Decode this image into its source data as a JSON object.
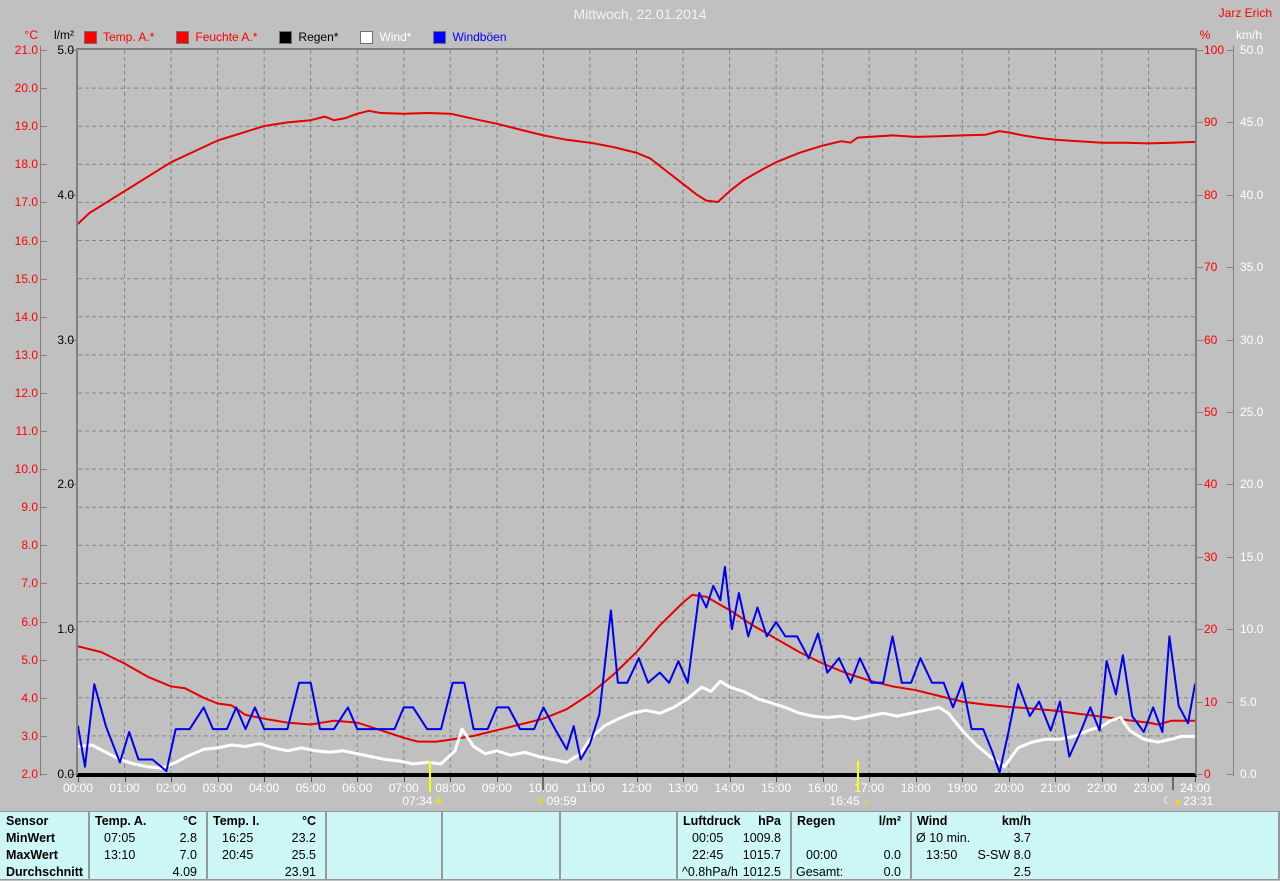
{
  "header": {
    "title": "Mittwoch, 22.01.2014",
    "author": "Jarz Erich"
  },
  "legend": [
    {
      "name": "temp-a",
      "label": "Temp. A.*",
      "swatch": "#ff0000",
      "text_color": "#ff0000"
    },
    {
      "name": "feuchte-a",
      "label": "Feuchte A.*",
      "swatch": "#ff0000",
      "text_color": "#ff0000"
    },
    {
      "name": "regen",
      "label": "Regen*",
      "swatch": "#000000",
      "text_color": "#000000"
    },
    {
      "name": "wind",
      "label": "Wind*",
      "swatch": "#ffffff",
      "text_color": "#ffffff"
    },
    {
      "name": "windboeen",
      "label": "Windböen",
      "swatch": "#0000ff",
      "text_color": "#0000ff"
    }
  ],
  "axes": {
    "temp": {
      "unit": "°C",
      "color": "#ff0000",
      "min": 2,
      "max": 21,
      "labels": [
        "21.0",
        "20.0",
        "19.0",
        "18.0",
        "17.0",
        "16.0",
        "15.0",
        "14.0",
        "13.0",
        "12.0",
        "11.0",
        "10.0",
        "9.0",
        "8.0",
        "7.0",
        "6.0",
        "5.0",
        "4.0",
        "3.0",
        "2.0"
      ]
    },
    "rain": {
      "unit": "l/m²",
      "color": "#000000",
      "min": 0,
      "max": 5,
      "labels": [
        "5.0",
        "4.0",
        "3.0",
        "2.0",
        "1.0",
        "0.0"
      ]
    },
    "humidity": {
      "unit": "%",
      "color": "#ff0000",
      "min": 0,
      "max": 100,
      "labels": [
        "100",
        "90",
        "80",
        "70",
        "60",
        "50",
        "40",
        "30",
        "20",
        "10",
        "0"
      ]
    },
    "wind": {
      "unit": "km/h",
      "color": "#ffffff",
      "min": 0,
      "max": 50,
      "labels": [
        "50.0",
        "45.0",
        "40.0",
        "35.0",
        "30.0",
        "25.0",
        "20.0",
        "15.0",
        "10.0",
        "5.0",
        "0.0"
      ]
    },
    "time": {
      "min": 0,
      "max": 24,
      "labels": [
        "00:00",
        "01:00",
        "02:00",
        "03:00",
        "04:00",
        "05:00",
        "06:00",
        "07:00",
        "08:00",
        "09:00",
        "10:00",
        "11:00",
        "12:00",
        "13:00",
        "14:00",
        "15:00",
        "16:00",
        "17:00",
        "18:00",
        "19:00",
        "20:00",
        "21:00",
        "22:00",
        "23:00",
        "24:00"
      ]
    }
  },
  "markers": [
    {
      "time": "07:34",
      "type": "sunrise",
      "icon": "sun"
    },
    {
      "time": "09:59",
      "type": "moonset",
      "icon": "arrow-down"
    },
    {
      "time": "16:45",
      "type": "sunset",
      "icon": "sun-outline"
    },
    {
      "time": "23:31",
      "type": "moonrise",
      "icon": "moon"
    }
  ],
  "chart_data": {
    "type": "line",
    "title": "Mittwoch, 22.01.2014",
    "x_range": [
      0,
      24
    ],
    "grid": "dashed hourly vertical, 1°C horizontal",
    "series": [
      {
        "name": "Feuchte A.",
        "unit": "%",
        "axis": "humidity",
        "color": "#e60000",
        "width": 2,
        "x": [
          0,
          0.25,
          0.5,
          0.75,
          1,
          1.5,
          2,
          2.5,
          3,
          3.5,
          4,
          4.5,
          5,
          5.3,
          5.5,
          5.75,
          6,
          6.25,
          6.5,
          7,
          7.5,
          8,
          8.5,
          9,
          9.5,
          10,
          10.5,
          11,
          11.5,
          12,
          12.3,
          12.6,
          13,
          13.3,
          13.5,
          13.75,
          14,
          14.3,
          14.7,
          15,
          15.5,
          16,
          16.4,
          16.6,
          16.75,
          17,
          17.5,
          18,
          18.5,
          19,
          19.5,
          19.8,
          20,
          20.3,
          20.7,
          21,
          21.5,
          22,
          22.5,
          23,
          23.5,
          24
        ],
        "y": [
          76,
          77.5,
          78.5,
          79.5,
          80.5,
          82.5,
          84.5,
          86,
          87.5,
          88.5,
          89.5,
          90,
          90.3,
          90.8,
          90.3,
          90.6,
          91.2,
          91.6,
          91.3,
          91.2,
          91.3,
          91.2,
          90.5,
          89.8,
          89,
          88.2,
          87.6,
          87.2,
          86.6,
          85.8,
          85,
          83.5,
          81.5,
          80,
          79.2,
          79,
          80.5,
          82,
          83.5,
          84.5,
          85.8,
          86.8,
          87.4,
          87.2,
          87.9,
          88,
          88.2,
          88,
          88.1,
          88.2,
          88.3,
          88.8,
          88.6,
          88.2,
          87.8,
          87.6,
          87.4,
          87.2,
          87.2,
          87.1,
          87.2,
          87.3
        ]
      },
      {
        "name": "Temp. A.",
        "unit": "°C",
        "axis": "temp",
        "color": "#e60000",
        "width": 2,
        "x": [
          0,
          0.5,
          1,
          1.5,
          2,
          2.3,
          2.7,
          3,
          3.3,
          3.6,
          4,
          4.5,
          5,
          5.5,
          6,
          6.5,
          7,
          7.3,
          7.7,
          8,
          8.5,
          9,
          9.5,
          10,
          10.5,
          11,
          11.5,
          12,
          12.5,
          13,
          13.2,
          13.5,
          14,
          14.5,
          15,
          15.5,
          16,
          16.5,
          17,
          17.5,
          18,
          18.5,
          19,
          19.5,
          20,
          20.5,
          21,
          21.5,
          22,
          22.5,
          23,
          23.2,
          23.5,
          24
        ],
        "y": [
          5.35,
          5.2,
          4.9,
          4.55,
          4.3,
          4.25,
          4.0,
          3.85,
          3.8,
          3.55,
          3.45,
          3.35,
          3.3,
          3.4,
          3.35,
          3.15,
          2.95,
          2.85,
          2.85,
          2.9,
          3.0,
          3.15,
          3.3,
          3.45,
          3.7,
          4.1,
          4.6,
          5.2,
          5.9,
          6.5,
          6.7,
          6.65,
          6.3,
          5.9,
          5.55,
          5.2,
          4.9,
          4.65,
          4.45,
          4.3,
          4.2,
          4.05,
          3.9,
          3.82,
          3.76,
          3.72,
          3.66,
          3.58,
          3.5,
          3.42,
          3.35,
          3.3,
          3.4,
          3.4
        ]
      },
      {
        "name": "Wind",
        "unit": "km/h",
        "axis": "wind",
        "color": "#ffffff",
        "width": 3,
        "x": [
          0,
          0.3,
          0.6,
          0.9,
          1.2,
          1.5,
          1.8,
          2.1,
          2.4,
          2.7,
          3,
          3.3,
          3.6,
          3.9,
          4.2,
          4.5,
          4.8,
          5.1,
          5.4,
          5.7,
          6,
          6.3,
          6.6,
          6.9,
          7.2,
          7.5,
          7.8,
          8.1,
          8.25,
          8.5,
          8.75,
          9,
          9.3,
          9.6,
          9.9,
          10.2,
          10.5,
          10.8,
          11,
          11.3,
          11.6,
          11.9,
          12.2,
          12.5,
          12.8,
          13.1,
          13.4,
          13.6,
          13.8,
          14,
          14.3,
          14.6,
          14.9,
          15.2,
          15.5,
          15.8,
          16.1,
          16.4,
          16.7,
          17,
          17.3,
          17.6,
          17.9,
          18.2,
          18.5,
          18.7,
          19,
          19.3,
          19.6,
          19.9,
          20.2,
          20.5,
          20.8,
          21.1,
          21.4,
          21.7,
          22,
          22.2,
          22.4,
          22.6,
          22.9,
          23.2,
          23.5,
          23.7,
          24
        ],
        "y": [
          1.9,
          2.0,
          1.5,
          1.0,
          0.7,
          0.5,
          0.4,
          0.8,
          1.3,
          1.7,
          1.8,
          2.0,
          1.9,
          2.1,
          1.8,
          1.6,
          1.8,
          1.6,
          1.5,
          1.6,
          1.4,
          1.2,
          1.0,
          0.9,
          0.7,
          0.8,
          0.7,
          1.6,
          3.1,
          1.9,
          1.4,
          1.6,
          1.3,
          1.5,
          1.2,
          1.0,
          0.8,
          1.4,
          2.4,
          3.3,
          3.8,
          4.2,
          4.4,
          4.2,
          4.6,
          5.2,
          6.0,
          5.7,
          6.4,
          6.0,
          5.7,
          5.2,
          4.9,
          4.6,
          4.2,
          4.0,
          3.9,
          4.0,
          3.8,
          4.0,
          4.2,
          4.0,
          4.2,
          4.4,
          4.6,
          4.2,
          3.0,
          2.0,
          1.2,
          0.5,
          1.8,
          2.2,
          2.4,
          2.4,
          2.6,
          3.0,
          3.3,
          3.7,
          3.9,
          3.0,
          2.4,
          2.2,
          2.4,
          2.6,
          2.6
        ]
      },
      {
        "name": "Windböen",
        "unit": "km/h",
        "axis": "wind",
        "color": "#0000f0",
        "width": 2,
        "x": [
          0,
          0.15,
          0.35,
          0.6,
          0.9,
          1.1,
          1.3,
          1.6,
          1.9,
          2.1,
          2.4,
          2.7,
          2.9,
          3.2,
          3.4,
          3.6,
          3.8,
          4.0,
          4.2,
          4.5,
          4.75,
          5.0,
          5.2,
          5.5,
          5.8,
          6.0,
          6.2,
          6.5,
          6.8,
          7.0,
          7.2,
          7.5,
          7.8,
          8.05,
          8.3,
          8.5,
          8.8,
          9.0,
          9.25,
          9.5,
          9.8,
          10.0,
          10.25,
          10.5,
          10.65,
          10.8,
          11.0,
          11.2,
          11.45,
          11.6,
          11.8,
          12.05,
          12.25,
          12.5,
          12.7,
          12.9,
          13.1,
          13.35,
          13.5,
          13.65,
          13.8,
          13.9,
          14.05,
          14.2,
          14.4,
          14.6,
          14.8,
          15.0,
          15.2,
          15.45,
          15.7,
          15.9,
          16.1,
          16.35,
          16.6,
          16.8,
          17.05,
          17.3,
          17.5,
          17.7,
          17.9,
          18.1,
          18.35,
          18.6,
          18.8,
          19.0,
          19.2,
          19.45,
          19.65,
          19.8,
          20.0,
          20.2,
          20.45,
          20.65,
          20.9,
          21.1,
          21.3,
          21.55,
          21.75,
          21.95,
          22.1,
          22.3,
          22.45,
          22.65,
          22.9,
          23.1,
          23.3,
          23.45,
          23.65,
          23.85,
          24.0
        ],
        "y": [
          3.3,
          0.5,
          6.2,
          3.3,
          0.8,
          2.9,
          1.0,
          1.0,
          0.2,
          3.1,
          3.1,
          4.6,
          3.1,
          3.1,
          4.6,
          3.1,
          4.6,
          3.1,
          3.1,
          3.1,
          6.3,
          6.3,
          3.1,
          3.1,
          4.6,
          3.1,
          3.1,
          3.1,
          3.1,
          4.6,
          4.6,
          3.1,
          3.1,
          6.3,
          6.3,
          3.1,
          3.1,
          4.6,
          4.6,
          3.1,
          3.1,
          4.6,
          3.1,
          1.7,
          3.3,
          1.0,
          2.1,
          4.1,
          11.3,
          6.3,
          6.3,
          8.0,
          6.3,
          7.0,
          6.3,
          7.8,
          6.3,
          12.5,
          11.5,
          13.0,
          12.0,
          14.3,
          10.0,
          12.5,
          9.5,
          11.5,
          9.5,
          10.5,
          9.5,
          9.5,
          8.0,
          9.7,
          7.0,
          8.0,
          6.3,
          8.0,
          6.3,
          6.3,
          9.5,
          6.3,
          6.3,
          8.0,
          6.3,
          6.3,
          4.6,
          6.3,
          3.1,
          3.1,
          1.5,
          0.1,
          3.0,
          6.2,
          4.0,
          5.0,
          3.0,
          5.0,
          1.2,
          3.0,
          4.6,
          3.0,
          7.8,
          5.5,
          8.2,
          4.0,
          2.9,
          4.6,
          2.9,
          9.5,
          4.7,
          3.5,
          6.2
        ]
      },
      {
        "name": "Regen",
        "unit": "l/m²",
        "axis": "rain",
        "color": "#000000",
        "width": 2,
        "x": [
          0,
          24
        ],
        "y": [
          0,
          0
        ]
      }
    ]
  },
  "table": {
    "row_headers": [
      "Sensor",
      "MinWert",
      "MaxWert",
      "Durchschnitt"
    ],
    "columns": [
      {
        "name": "temp-a",
        "header": "Temp. A.",
        "unit": "°C",
        "rows": [
          [
            "07:05",
            "2.8"
          ],
          [
            "13:10",
            "7.0"
          ],
          [
            "",
            "4.09"
          ]
        ]
      },
      {
        "name": "temp-i",
        "header": "Temp. I.",
        "unit": "°C",
        "rows": [
          [
            "16:25",
            "23.2"
          ],
          [
            "20:45",
            "25.5"
          ],
          [
            "",
            "23.91"
          ]
        ]
      },
      {
        "name": "empty-1",
        "header": "",
        "unit": "",
        "rows": [
          [
            "",
            ""
          ],
          [
            "",
            ""
          ],
          [
            "",
            ""
          ]
        ]
      },
      {
        "name": "empty-2",
        "header": "",
        "unit": "",
        "rows": [
          [
            "",
            ""
          ],
          [
            "",
            ""
          ],
          [
            "",
            ""
          ]
        ]
      },
      {
        "name": "empty-3",
        "header": "",
        "unit": "",
        "rows": [
          [
            "",
            ""
          ],
          [
            "",
            ""
          ],
          [
            "",
            ""
          ]
        ]
      },
      {
        "name": "luftdruck",
        "header": "Luftdruck",
        "unit": "hPa",
        "rows": [
          [
            "00:05",
            "1009.8"
          ],
          [
            "22:45",
            "1015.7"
          ],
          [
            "^0.8hPa/h",
            "1012.5"
          ]
        ]
      },
      {
        "name": "regen",
        "header": "Regen",
        "unit": "l/m²",
        "rows": [
          [
            "",
            ""
          ],
          [
            "00:00",
            "0.0"
          ],
          [
            "Gesamt:",
            "0.0"
          ]
        ]
      },
      {
        "name": "wind",
        "header": "Wind",
        "unit": "km/h",
        "rows": [
          [
            "Ø 10 min.",
            "3.7"
          ],
          [
            "13:50",
            "S-SW 8.0"
          ],
          [
            "",
            "2.5"
          ]
        ]
      }
    ]
  }
}
